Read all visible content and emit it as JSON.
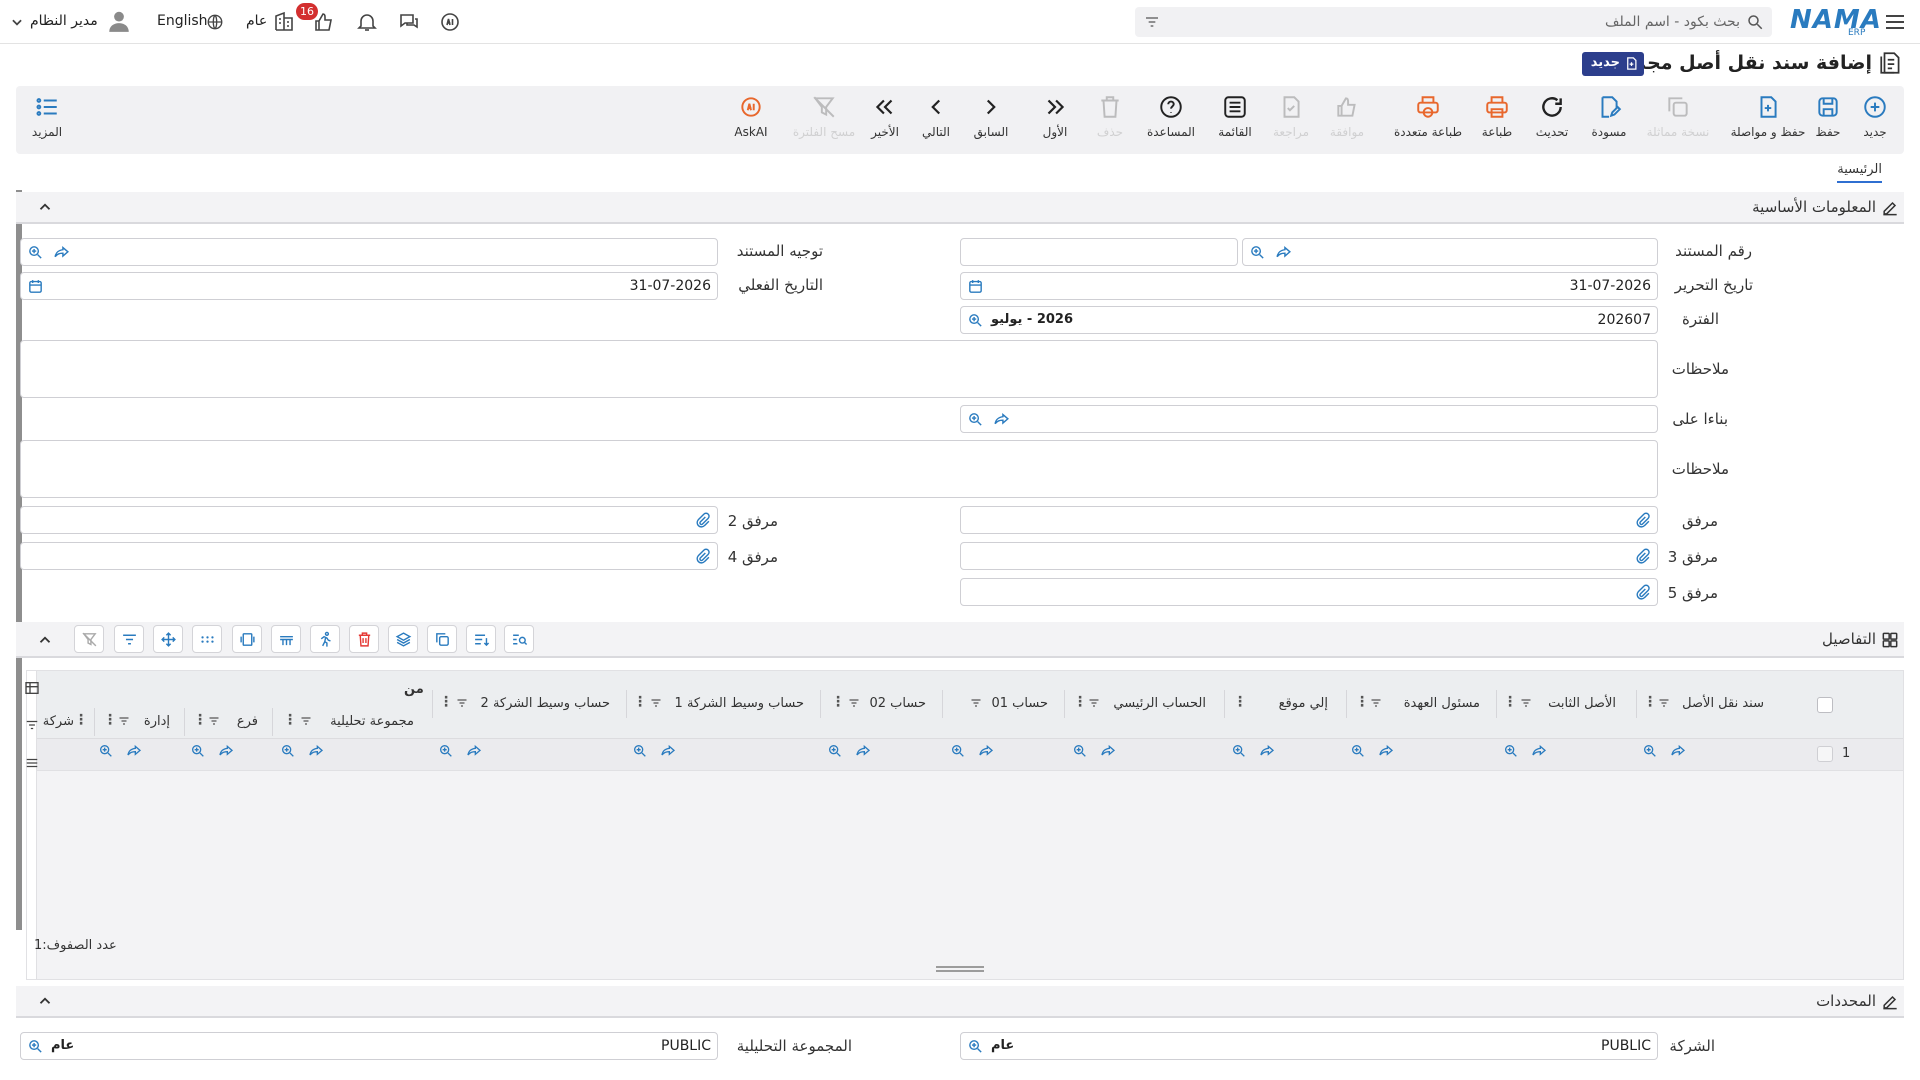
{
  "header": {
    "search_placeholder": "بحث بكود - اسم الملف",
    "logo_text": "NAMA",
    "logo_sub": "ERP",
    "user_name": "مدير النظام",
    "language": "English",
    "scope_label": "عام",
    "notification_count": "16"
  },
  "page": {
    "title": "إضافة سند نقل أصل مجمع",
    "new_badge": "جديد",
    "tab_main": "الرئيسية"
  },
  "toolbar": {
    "new": "جديد",
    "save": "حفظ",
    "save_continue": "حفظ و مواصلة",
    "duplicate": "نسخة مماثلة",
    "draft": "مسودة",
    "refresh": "تحديث",
    "print": "طباعة",
    "multi_print": "طباعة متعددة",
    "approve": "موافقة",
    "review": "مراجعة",
    "list": "القائمة",
    "help": "المساعدة",
    "delete": "حذف",
    "first": "الأول",
    "previous": "السابق",
    "next": "التالي",
    "last": "الأخير",
    "clear_filter": "مسح الفلترة",
    "askai": "AskAI",
    "more": "المزيد"
  },
  "basic_info": {
    "section_title": "المعلومات الأساسية",
    "doc_number_label": "رقم المستند",
    "doc_direction_label": "توجيه المستند",
    "edit_date_label": "تاريخ التحرير",
    "edit_date_value": "31-07-2026",
    "actual_date_label": "التاريخ الفعلي",
    "actual_date_value": "31-07-2026",
    "period_label": "الفترة",
    "period_value": "202607",
    "period_name": "2026 - يوليو",
    "notes_label": "ملاحظات",
    "based_on_label": "بناءا على",
    "notes2_label": "ملاحظات",
    "attachment_label": "مرفق",
    "attachment2_label": "مرفق 2",
    "attachment3_label": "مرفق 3",
    "attachment4_label": "مرفق 4",
    "attachment5_label": "مرفق 5"
  },
  "details": {
    "section_title": "التفاصيل",
    "group_from": "من",
    "columns": [
      "سند نقل الأصل",
      "الأصل الثابت",
      "مسئول العهدة",
      "إلي موقع",
      "الحساب الرئيسي",
      "حساب 01",
      "حساب 02",
      "حساب وسيط الشركة 1",
      "حساب وسيط الشركة 2",
      "مجموعة تحليلية",
      "فرع",
      "إدارة",
      "شركة"
    ],
    "row_number": "1",
    "row_count_label": "عدد الصفوف:",
    "row_count_value": "1"
  },
  "determinants": {
    "section_title": "المحددات",
    "company_label": "الشركة",
    "company_value": "PUBLIC",
    "company_name": "عام",
    "analytic_group_label": "المجموعة التحليلية",
    "analytic_group_value": "PUBLIC",
    "analytic_group_name": "عام"
  }
}
